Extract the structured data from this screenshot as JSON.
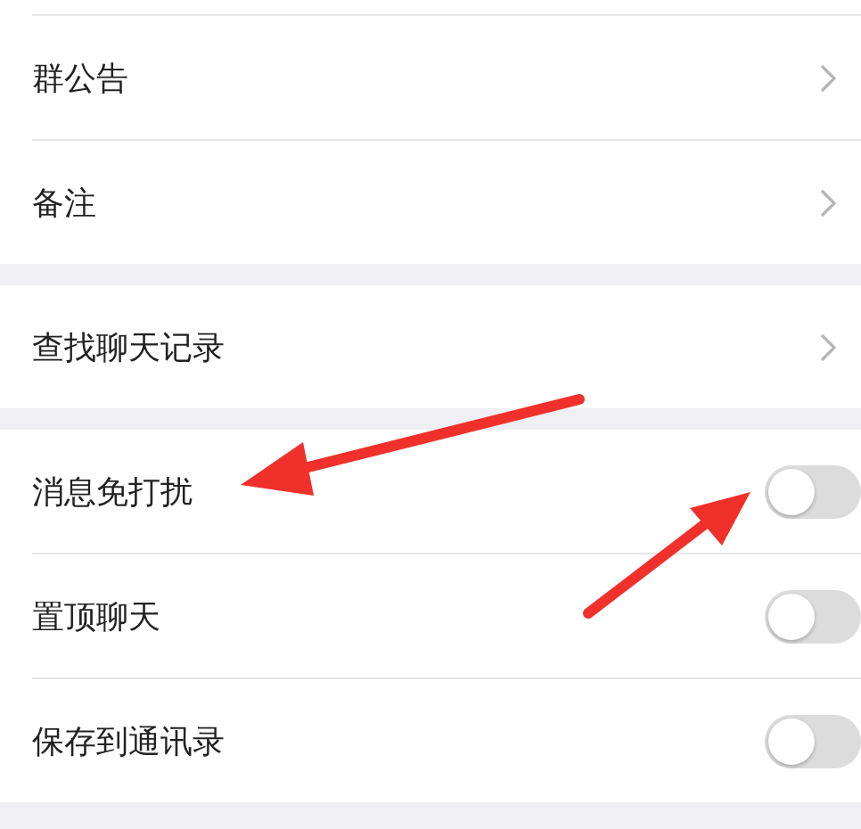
{
  "groups": [
    {
      "rows": [
        {
          "kind": "link",
          "label": "群公告"
        },
        {
          "kind": "link",
          "label": "备注"
        }
      ]
    },
    {
      "rows": [
        {
          "kind": "link",
          "label": "查找聊天记录"
        }
      ]
    },
    {
      "rows": [
        {
          "kind": "toggle",
          "label": "消息免打扰",
          "on": false
        },
        {
          "kind": "toggle",
          "label": "置顶聊天",
          "on": false
        },
        {
          "kind": "toggle",
          "label": "保存到通讯录",
          "on": false
        }
      ]
    }
  ]
}
